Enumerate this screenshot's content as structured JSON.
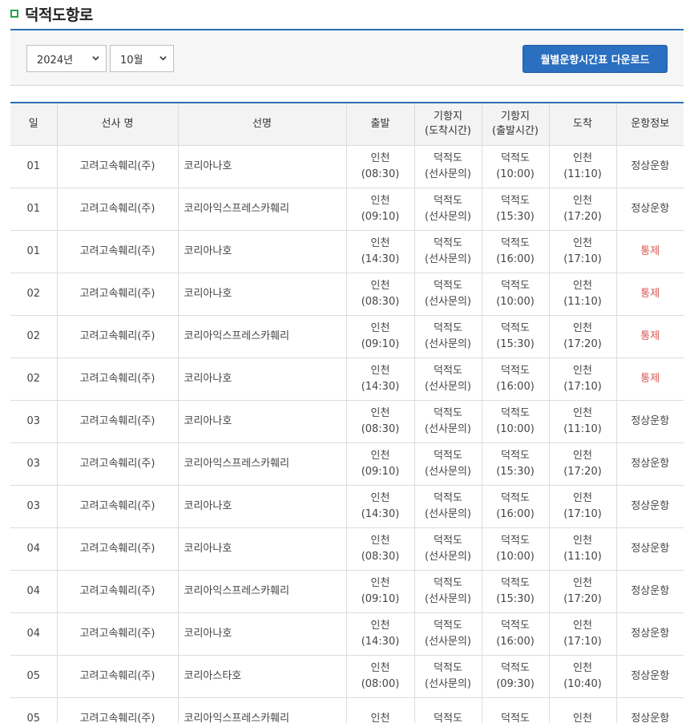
{
  "page": {
    "title": "덕적도항로"
  },
  "filters": {
    "year": "2024년",
    "month": "10월",
    "download_label": "월별운항시간표 다운로드"
  },
  "table": {
    "headers": [
      "일",
      "선사 명",
      "선명",
      "출발",
      "기항지\n(도착시간)",
      "기항지\n(출발시간)",
      "도착",
      "운항정보"
    ],
    "rows": [
      {
        "day": "01",
        "company": "고려고속훼리(주)",
        "ship": "코리아나호",
        "dep_place": "인천",
        "dep_time": "(08:30)",
        "port_arr_place": "덕적도",
        "port_arr_time": "(선사문의)",
        "port_dep_place": "덕적도",
        "port_dep_time": "(10:00)",
        "arr_place": "인천",
        "arr_time": "(11:10)",
        "status": "정상운항"
      },
      {
        "day": "01",
        "company": "고려고속훼리(주)",
        "ship": "코리아익스프레스카훼리",
        "dep_place": "인천",
        "dep_time": "(09:10)",
        "port_arr_place": "덕적도",
        "port_arr_time": "(선사문의)",
        "port_dep_place": "덕적도",
        "port_dep_time": "(15:30)",
        "arr_place": "인천",
        "arr_time": "(17:20)",
        "status": "정상운항"
      },
      {
        "day": "01",
        "company": "고려고속훼리(주)",
        "ship": "코리아나호",
        "dep_place": "인천",
        "dep_time": "(14:30)",
        "port_arr_place": "덕적도",
        "port_arr_time": "(선사문의)",
        "port_dep_place": "덕적도",
        "port_dep_time": "(16:00)",
        "arr_place": "인천",
        "arr_time": "(17:10)",
        "status": "통제"
      },
      {
        "day": "02",
        "company": "고려고속훼리(주)",
        "ship": "코리아나호",
        "dep_place": "인천",
        "dep_time": "(08:30)",
        "port_arr_place": "덕적도",
        "port_arr_time": "(선사문의)",
        "port_dep_place": "덕적도",
        "port_dep_time": "(10:00)",
        "arr_place": "인천",
        "arr_time": "(11:10)",
        "status": "통제"
      },
      {
        "day": "02",
        "company": "고려고속훼리(주)",
        "ship": "코리아익스프레스카훼리",
        "dep_place": "인천",
        "dep_time": "(09:10)",
        "port_arr_place": "덕적도",
        "port_arr_time": "(선사문의)",
        "port_dep_place": "덕적도",
        "port_dep_time": "(15:30)",
        "arr_place": "인천",
        "arr_time": "(17:20)",
        "status": "통제"
      },
      {
        "day": "02",
        "company": "고려고속훼리(주)",
        "ship": "코리아나호",
        "dep_place": "인천",
        "dep_time": "(14:30)",
        "port_arr_place": "덕적도",
        "port_arr_time": "(선사문의)",
        "port_dep_place": "덕적도",
        "port_dep_time": "(16:00)",
        "arr_place": "인천",
        "arr_time": "(17:10)",
        "status": "통제"
      },
      {
        "day": "03",
        "company": "고려고속훼리(주)",
        "ship": "코리아나호",
        "dep_place": "인천",
        "dep_time": "(08:30)",
        "port_arr_place": "덕적도",
        "port_arr_time": "(선사문의)",
        "port_dep_place": "덕적도",
        "port_dep_time": "(10:00)",
        "arr_place": "인천",
        "arr_time": "(11:10)",
        "status": "정상운항"
      },
      {
        "day": "03",
        "company": "고려고속훼리(주)",
        "ship": "코리아익스프레스카훼리",
        "dep_place": "인천",
        "dep_time": "(09:10)",
        "port_arr_place": "덕적도",
        "port_arr_time": "(선사문의)",
        "port_dep_place": "덕적도",
        "port_dep_time": "(15:30)",
        "arr_place": "인천",
        "arr_time": "(17:20)",
        "status": "정상운항"
      },
      {
        "day": "03",
        "company": "고려고속훼리(주)",
        "ship": "코리아나호",
        "dep_place": "인천",
        "dep_time": "(14:30)",
        "port_arr_place": "덕적도",
        "port_arr_time": "(선사문의)",
        "port_dep_place": "덕적도",
        "port_dep_time": "(16:00)",
        "arr_place": "인천",
        "arr_time": "(17:10)",
        "status": "정상운항"
      },
      {
        "day": "04",
        "company": "고려고속훼리(주)",
        "ship": "코리아나호",
        "dep_place": "인천",
        "dep_time": "(08:30)",
        "port_arr_place": "덕적도",
        "port_arr_time": "(선사문의)",
        "port_dep_place": "덕적도",
        "port_dep_time": "(10:00)",
        "arr_place": "인천",
        "arr_time": "(11:10)",
        "status": "정상운항"
      },
      {
        "day": "04",
        "company": "고려고속훼리(주)",
        "ship": "코리아익스프레스카훼리",
        "dep_place": "인천",
        "dep_time": "(09:10)",
        "port_arr_place": "덕적도",
        "port_arr_time": "(선사문의)",
        "port_dep_place": "덕적도",
        "port_dep_time": "(15:30)",
        "arr_place": "인천",
        "arr_time": "(17:20)",
        "status": "정상운항"
      },
      {
        "day": "04",
        "company": "고려고속훼리(주)",
        "ship": "코리아나호",
        "dep_place": "인천",
        "dep_time": "(14:30)",
        "port_arr_place": "덕적도",
        "port_arr_time": "(선사문의)",
        "port_dep_place": "덕적도",
        "port_dep_time": "(16:00)",
        "arr_place": "인천",
        "arr_time": "(17:10)",
        "status": "정상운항"
      },
      {
        "day": "05",
        "company": "고려고속훼리(주)",
        "ship": "코리아스타호",
        "dep_place": "인천",
        "dep_time": "(08:00)",
        "port_arr_place": "덕적도",
        "port_arr_time": "(선사문의)",
        "port_dep_place": "덕적도",
        "port_dep_time": "(09:30)",
        "arr_place": "인천",
        "arr_time": "(10:40)",
        "status": "정상운항"
      },
      {
        "day": "05",
        "company": "고려고속훼리(주)",
        "ship": "코리아익스프레스카훼리",
        "dep_place": "인천",
        "dep_time": "",
        "port_arr_place": "덕적도",
        "port_arr_time": "",
        "port_dep_place": "덕적도",
        "port_dep_time": "",
        "arr_place": "인천",
        "arr_time": "",
        "status": "정상운항"
      }
    ]
  },
  "colors": {
    "accent": "#2f6db3",
    "button": "#2a6fc0",
    "status_control": "#d9534f",
    "title_mark": "#2aa24a"
  }
}
